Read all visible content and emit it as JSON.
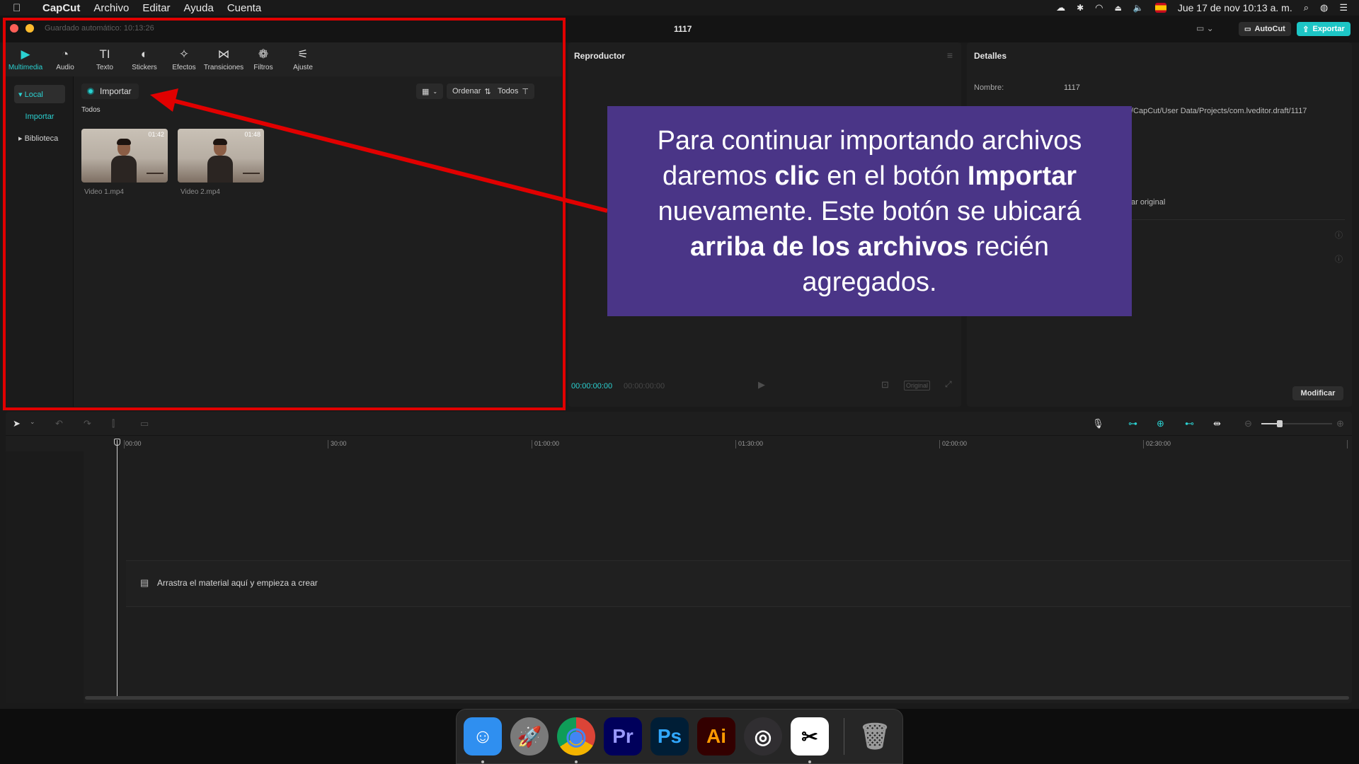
{
  "menubar": {
    "app_name": "CapCut",
    "items": [
      "Archivo",
      "Editar",
      "Ayuda",
      "Cuenta"
    ],
    "datetime": "Jue 17 de nov  10:13 a. m."
  },
  "titlebar": {
    "autosave": "Guardado automático: 10:13:26",
    "project": "1117",
    "autocut": "AutoCut",
    "export": "Exportar"
  },
  "media": {
    "tools": [
      {
        "label": "Multimedia",
        "icon": "▶"
      },
      {
        "label": "Audio",
        "icon": "◔"
      },
      {
        "label": "Texto",
        "icon": "TI"
      },
      {
        "label": "Stickers",
        "icon": "◐"
      },
      {
        "label": "Efectos",
        "icon": "✧"
      },
      {
        "label": "Transiciones",
        "icon": "⋈"
      },
      {
        "label": "Filtros",
        "icon": "❁"
      },
      {
        "label": "Ajuste",
        "icon": "⚟"
      }
    ],
    "side": {
      "local": "▾ Local",
      "importar": "Importar",
      "biblioteca": "▸ Biblioteca"
    },
    "import_label": "Importar",
    "order_label": "Ordenar",
    "todos_filter": "Todos",
    "section_label": "Todos",
    "clips": [
      {
        "name": "Video 1.mp4",
        "duration": "01:42"
      },
      {
        "name": "Video 2.mp4",
        "duration": "01:48"
      }
    ]
  },
  "player": {
    "title": "Reproductor",
    "time_current": "00:00:00:00",
    "time_total": "00:00:00:00",
    "original": "Original"
  },
  "details": {
    "title": "Detalles",
    "name_label": "Nombre:",
    "name_value": "1117",
    "path_fragment": "/CapCut/User Data/Projects/com.lveditor.draft/1117",
    "original_fragment": "ar original",
    "modify": "Modificar"
  },
  "timeline": {
    "ruler": [
      "00:00",
      "30:00",
      "01:00:00",
      "01:30:00",
      "02:00:00",
      "02:30:00"
    ],
    "drop_text": "Arrastra el material aquí y empieza a crear"
  },
  "callout": {
    "part1": "Para continuar importando archivos daremos ",
    "bold1": "clic",
    "part2": " en el botón ",
    "bold2": "Importar",
    "part3": " nuevamente. Este botón se ubicará ",
    "bold3": "arriba de los archivos",
    "part4": " recién agregados."
  },
  "dock": {
    "apps": [
      {
        "name": "Finder",
        "glyph": "☺",
        "bg": "#2f8ff0",
        "color": "#ffffff"
      },
      {
        "name": "Launchpad",
        "glyph": "🚀",
        "bg": "#8a8a8a",
        "color": "#ffffff"
      },
      {
        "name": "Chrome",
        "glyph": "◉",
        "bg": "#eaeaea",
        "color": "#db4437"
      },
      {
        "name": "Premiere Pro",
        "glyph": "Pr",
        "bg": "#00005b",
        "color": "#9999ff"
      },
      {
        "name": "Photoshop",
        "glyph": "Ps",
        "bg": "#001e36",
        "color": "#31a8ff"
      },
      {
        "name": "Illustrator",
        "glyph": "Ai",
        "bg": "#330000",
        "color": "#ff9a00"
      },
      {
        "name": "OBS",
        "glyph": "◎",
        "bg": "#302e31",
        "color": "#ffffff"
      },
      {
        "name": "CapCut",
        "glyph": "✂",
        "bg": "#ffffff",
        "color": "#000000"
      }
    ],
    "trash": "Papelera"
  },
  "colors": {
    "accent": "#2bd1d1",
    "annotation_red": "#e10000",
    "callout_bg": "#4a3587"
  }
}
